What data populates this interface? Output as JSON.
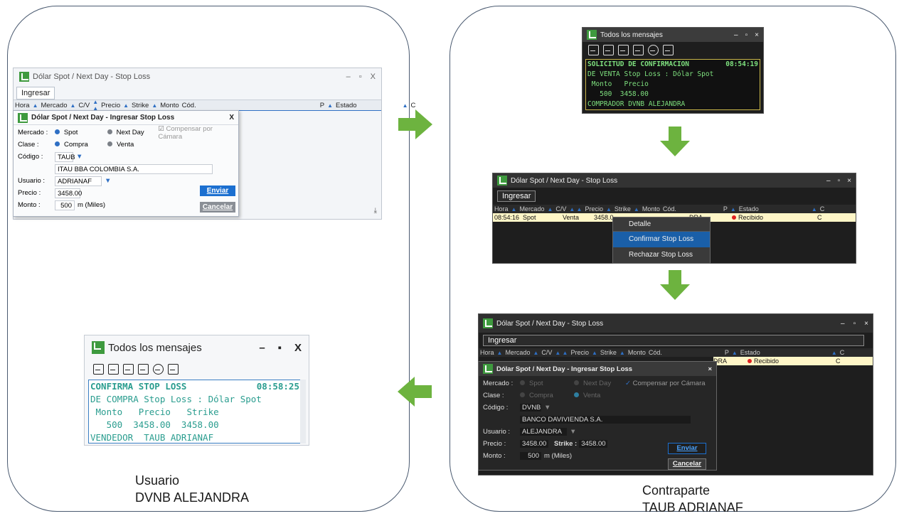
{
  "captions": {
    "left": [
      "Usuario",
      "DVNB ALEJANDRA"
    ],
    "right": [
      "Contraparte",
      "TAUB ADRIANAF"
    ]
  },
  "colors": {
    "arrow": "#6db33f",
    "panel_border": "#4a5a70",
    "accent_blue": "#1b6fd0"
  },
  "main_window": {
    "title": "Dólar Spot / Next Day - Stop Loss",
    "tab": "Ingresar",
    "columns": [
      "Hora",
      "Mercado",
      "C/V",
      "Precio",
      "Strike",
      "Monto",
      "Cód.",
      "P",
      "Estado",
      "C"
    ]
  },
  "dialog": {
    "title": "Dólar Spot / Next Day - Ingresar Stop Loss",
    "mercado_label": "Mercado :",
    "spot": "Spot",
    "next_day": "Next Day",
    "compensar": "Compensar por Cámara",
    "clase_label": "Clase :",
    "compra": "Compra",
    "venta": "Venta",
    "codigo_label": "Código :",
    "usuario_label": "Usuario :",
    "precio_label": "Precio :",
    "monto_label": "Monto :",
    "strike_label": "Strike :",
    "monto_unit": "m (Miles)",
    "enviar": "Enviar",
    "cancelar": "Cancelar",
    "close": "X"
  },
  "left_dialog": {
    "codigo": "TAUB",
    "entidad": "ITAU BBA COLOMBIA S.A.",
    "usuario": "ADRIANAF",
    "precio": "3458.00",
    "monto": "500"
  },
  "msg_window_title": "Todos los mensajes",
  "msg_top": {
    "line1": "SOLICITUD DE CONFIRMACION",
    "time": "08:54:19",
    "line2": "DE VENTA Stop Loss : Dólar Spot",
    "line3": " Monto   Precio",
    "line4": "   500  3458.00",
    "line5": "COMPRADOR DVNB ALEJANDRA"
  },
  "msg_left": {
    "line1": "CONFIRMA STOP LOSS",
    "time": "08:58:25",
    "line2": "DE COMPRA Stop Loss : Dólar Spot",
    "line3": " Monto   Precio   Strike",
    "line4": "   500  3458.00  3458.00",
    "line5": "VENDEDOR  TAUB ADRIANAF"
  },
  "dark_row": {
    "hora": "08:54:16",
    "mercado": "Spot",
    "cv": "Venta",
    "precio": "3458.0",
    "contraparte": "DRA",
    "estado": "Recibido",
    "c": "C"
  },
  "context_menu": [
    "Detalle",
    "Confirmar Stop Loss",
    "Rechazar Stop Loss"
  ],
  "right_dialog": {
    "codigo": "DVNB",
    "entidad": "BANCO DAVIVIENDA S.A.",
    "usuario": "ALEJANDRA",
    "precio": "3458.00",
    "strike": "3458.00",
    "monto": "500"
  }
}
